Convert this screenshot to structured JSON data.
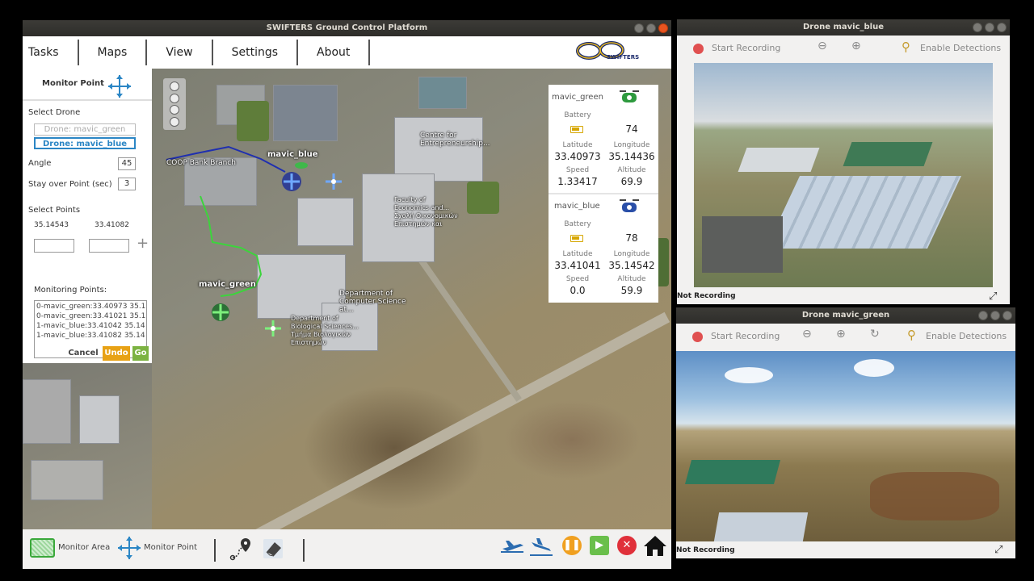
{
  "main_window": {
    "title": "SWIFTERS  Ground Control Platform",
    "menu": [
      "Tasks",
      "Maps",
      "View",
      "Settings",
      "About"
    ],
    "logo_text": "SWIFTERS"
  },
  "monitor_panel": {
    "title": "Monitor Point",
    "select_drone_label": "Select Drone",
    "drone_options": [
      "Drone: mavic_green",
      "Drone: mavic_blue"
    ],
    "selected_drone": "Drone: mavic_blue",
    "angle_label": "Angle",
    "angle_value": "45",
    "stay_label": "Stay over Point (sec)",
    "stay_value": "3",
    "select_points_label": "Select Points",
    "lon_value": "35.14543",
    "lat_value": "33.41082",
    "monitoring_label": "Monitoring Points:",
    "monitoring_points": [
      "0-mavic_green:33.40973 35.1",
      "0-mavic_green:33.41021 35.1",
      "1-mavic_blue:33.41042 35.14",
      "1-mavic_blue:33.41082 35.14"
    ],
    "cancel_label": "Cancel",
    "undo_label": "Undo",
    "go_label": "Go"
  },
  "map": {
    "labels": {
      "bank": "COOP Bank Branch",
      "centre": "Centre for\nEntrepreneurship...",
      "economics": "Faculty of\nEconomics and...\nΣχολή Οικονομικών\nΕπιστημών και",
      "cs": "Department of\nComputer Science at...",
      "bio": "Department of\nBiological Sciences...\nΤμήμα Βιολογικών\nΕπιστημών"
    },
    "drone_labels": [
      "mavic_blue",
      "mavic_green"
    ]
  },
  "drone_status": [
    {
      "name": "mavic_green",
      "battery_label": "Battery",
      "battery": "74",
      "lat_label": "Latitude",
      "lat": "33.40973",
      "lon_label": "Longitude",
      "lon": "35.14436",
      "speed_label": "Speed",
      "speed": "1.33417",
      "alt_label": "Altitude",
      "alt": "69.9",
      "icon_color": "#2e9a3e"
    },
    {
      "name": "mavic_blue",
      "battery_label": "Battery",
      "battery": "78",
      "lat_label": "Latitude",
      "lat": "33.41041",
      "lon_label": "Longitude",
      "lon": "35.14542",
      "speed_label": "Speed",
      "speed": "0.0",
      "alt_label": "Altitude",
      "alt": "59.9",
      "icon_color": "#2a4fa8"
    }
  ],
  "bottom_bar": {
    "monitor_area_label": "Monitor Area",
    "monitor_point_label": "Monitor Point"
  },
  "video_blue": {
    "title": "Drone mavic_blue",
    "start_recording": "Start Recording",
    "enable_detections": "Enable Detections",
    "status": "Not Recording"
  },
  "video_green": {
    "title": "Drone mavic_green",
    "start_recording": "Start Recording",
    "enable_detections": "Enable Detections",
    "status": "Not Recording"
  },
  "colors": {
    "accent_blue": "#2b86c5",
    "undo_orange": "#e8a215",
    "go_green": "#7cb342",
    "pause_orange": "#f0a020",
    "play_green": "#6abf4b",
    "stop_red": "#e0303a",
    "path_blue": "#1f2fb0",
    "path_green": "#3cd43c"
  }
}
